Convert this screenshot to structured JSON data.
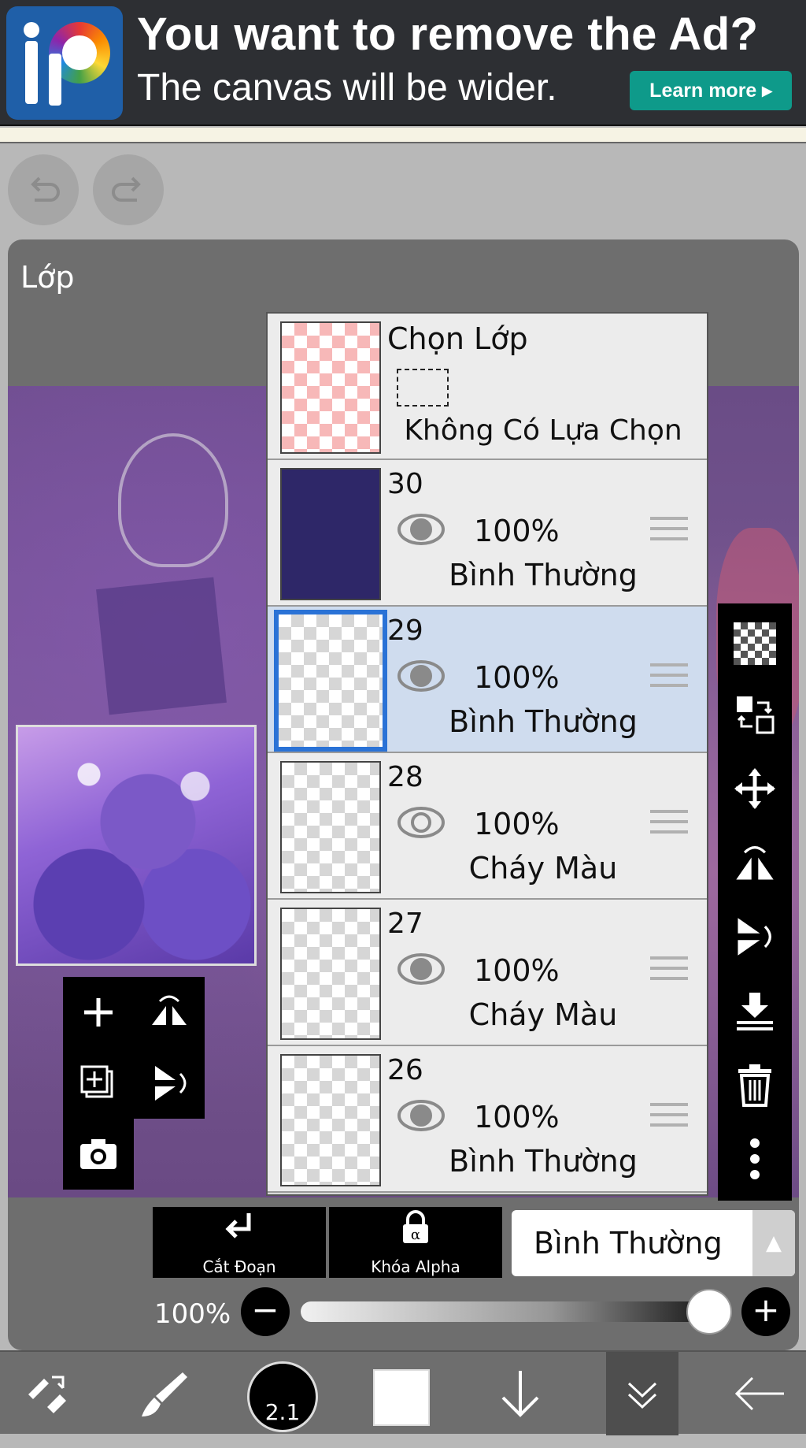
{
  "ad": {
    "headline": "You want to remove the Ad?",
    "subline": "The canvas will be wider.",
    "cta": "Learn more ▸",
    "logo_icon": "ibis-paint-logo"
  },
  "toolbar_top": {
    "undo_icon": "undo-icon",
    "redo_icon": "redo-icon"
  },
  "panel": {
    "title": "Lớp"
  },
  "layers": {
    "selection_row": {
      "title": "Chọn Lớp",
      "status": "Không Có Lựa Chọn"
    },
    "items": [
      {
        "number": "30",
        "opacity": "100%",
        "mode": "Bình Thường",
        "visible": true,
        "selected": false,
        "thumb": "navy"
      },
      {
        "number": "29",
        "opacity": "100%",
        "mode": "Bình Thường",
        "visible": true,
        "selected": true,
        "thumb": "transparent"
      },
      {
        "number": "28",
        "opacity": "100%",
        "mode": "Cháy Màu",
        "visible": false,
        "selected": false,
        "thumb": "transparent"
      },
      {
        "number": "27",
        "opacity": "100%",
        "mode": "Cháy Màu",
        "visible": true,
        "selected": false,
        "thumb": "transparent"
      },
      {
        "number": "26",
        "opacity": "100%",
        "mode": "Bình Thường",
        "visible": true,
        "selected": false,
        "thumb": "transparent"
      }
    ]
  },
  "left_tools": [
    "add-layer-icon",
    "flip-horizontal-icon",
    "add-special-layer-icon",
    "flip-vertical-icon",
    "camera-icon"
  ],
  "right_tools": [
    "transparency-icon",
    "layer-swap-icon",
    "move-icon",
    "flip-horizontal-icon",
    "flip-vertical-icon",
    "merge-down-icon",
    "trash-icon",
    "more-icon"
  ],
  "controls": {
    "clipping_label": "Cắt Đoạn",
    "alpha_lock_label": "Khóa Alpha",
    "blend_mode": "Bình Thường",
    "opacity_label": "100%",
    "opacity_value": 1.0
  },
  "bottom_bar": {
    "brush_size": "2.1",
    "icons": [
      "tool-select-icon",
      "brush-icon",
      "brush-size-icon",
      "color-icon",
      "download-icon",
      "layers-icon",
      "back-icon"
    ]
  }
}
